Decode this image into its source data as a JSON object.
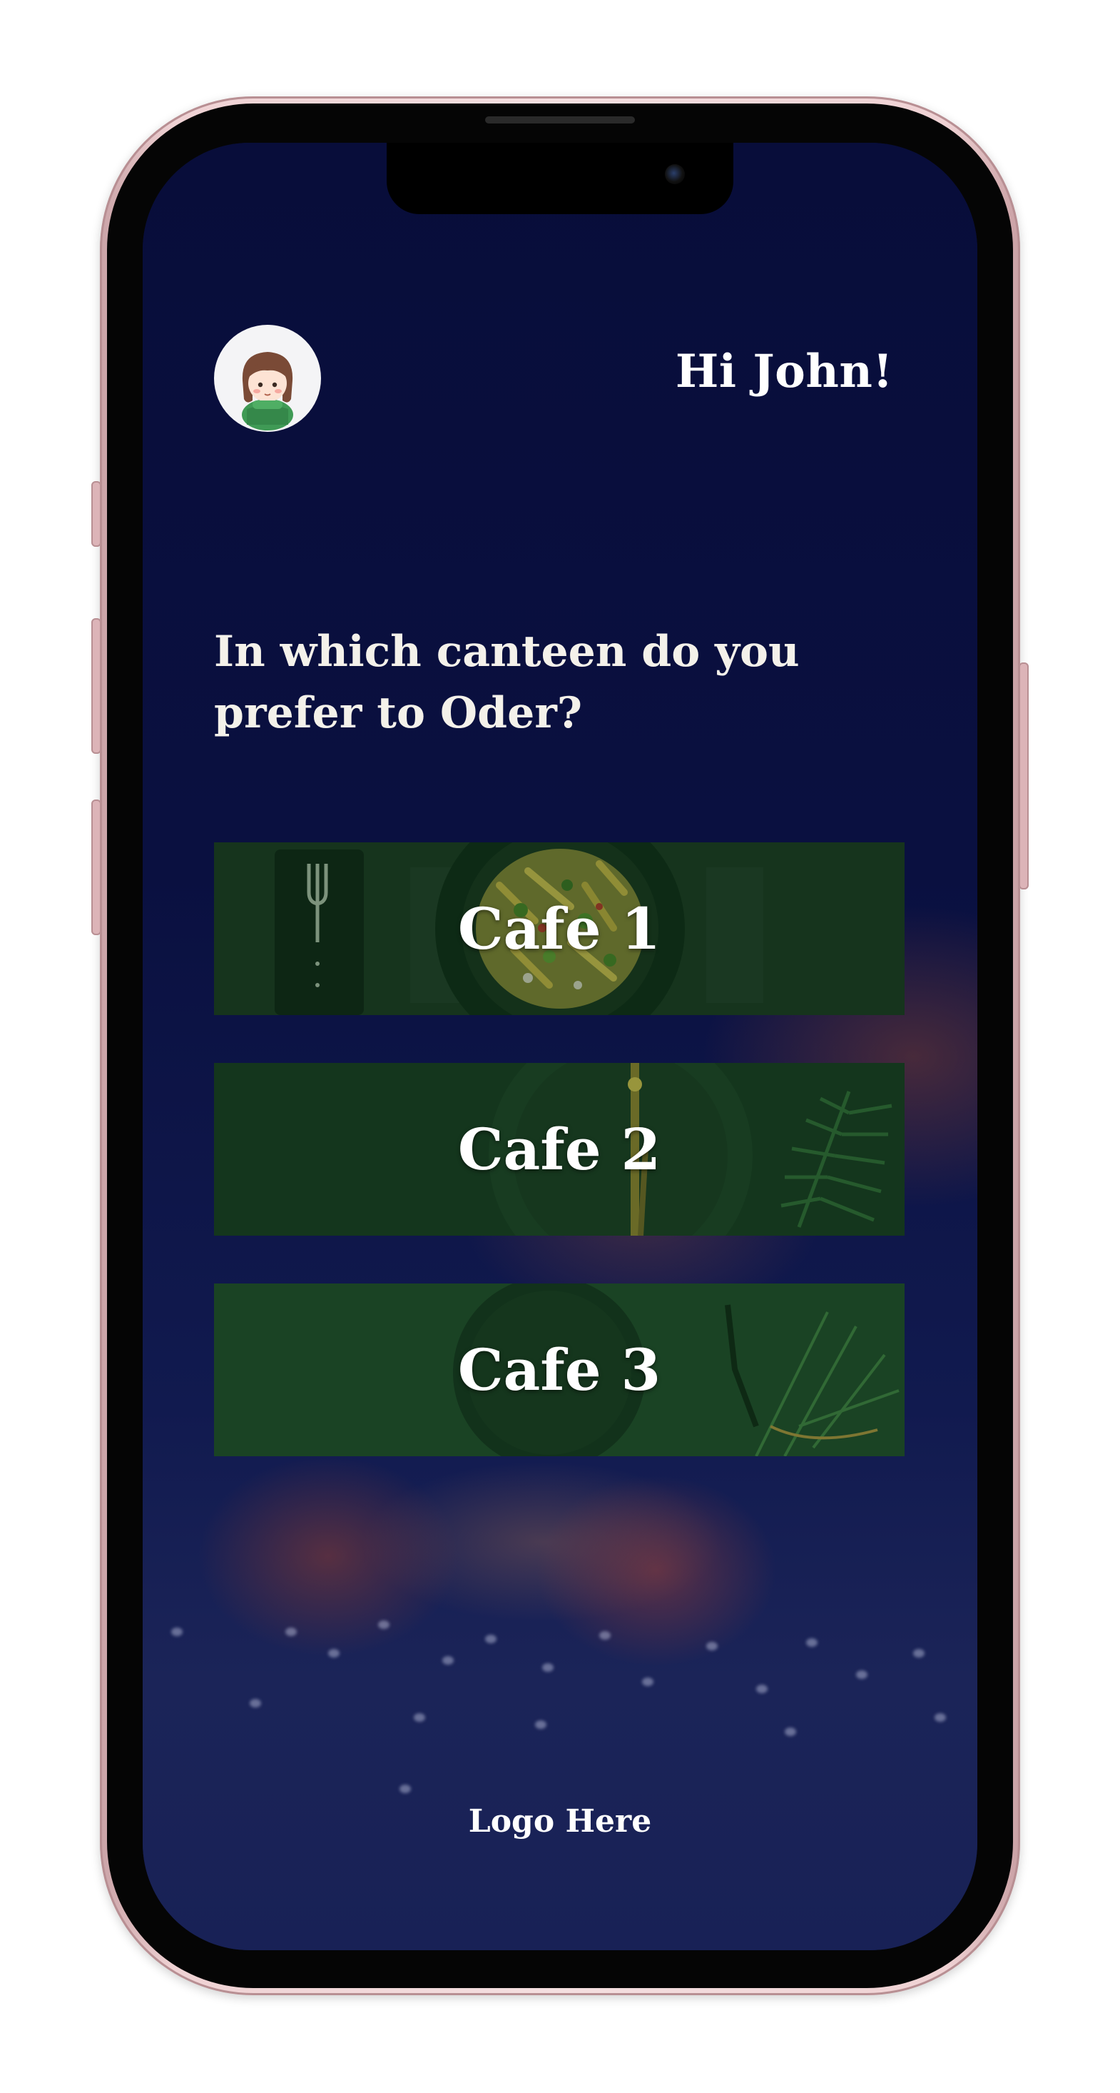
{
  "header": {
    "greeting": "Hi John!",
    "avatar_icon": "girl-avatar-icon"
  },
  "main": {
    "question": "In which canteen do you prefer to Oder?",
    "cafes": [
      {
        "label": "Cafe 1"
      },
      {
        "label": "Cafe 2"
      },
      {
        "label": "Cafe 3"
      }
    ]
  },
  "footer": {
    "logo": "Logo Here"
  },
  "colors": {
    "screen_bg": "#0b1140",
    "card_green": "#173a1f",
    "text": "#ffffff",
    "frame": "#efd2d4"
  }
}
